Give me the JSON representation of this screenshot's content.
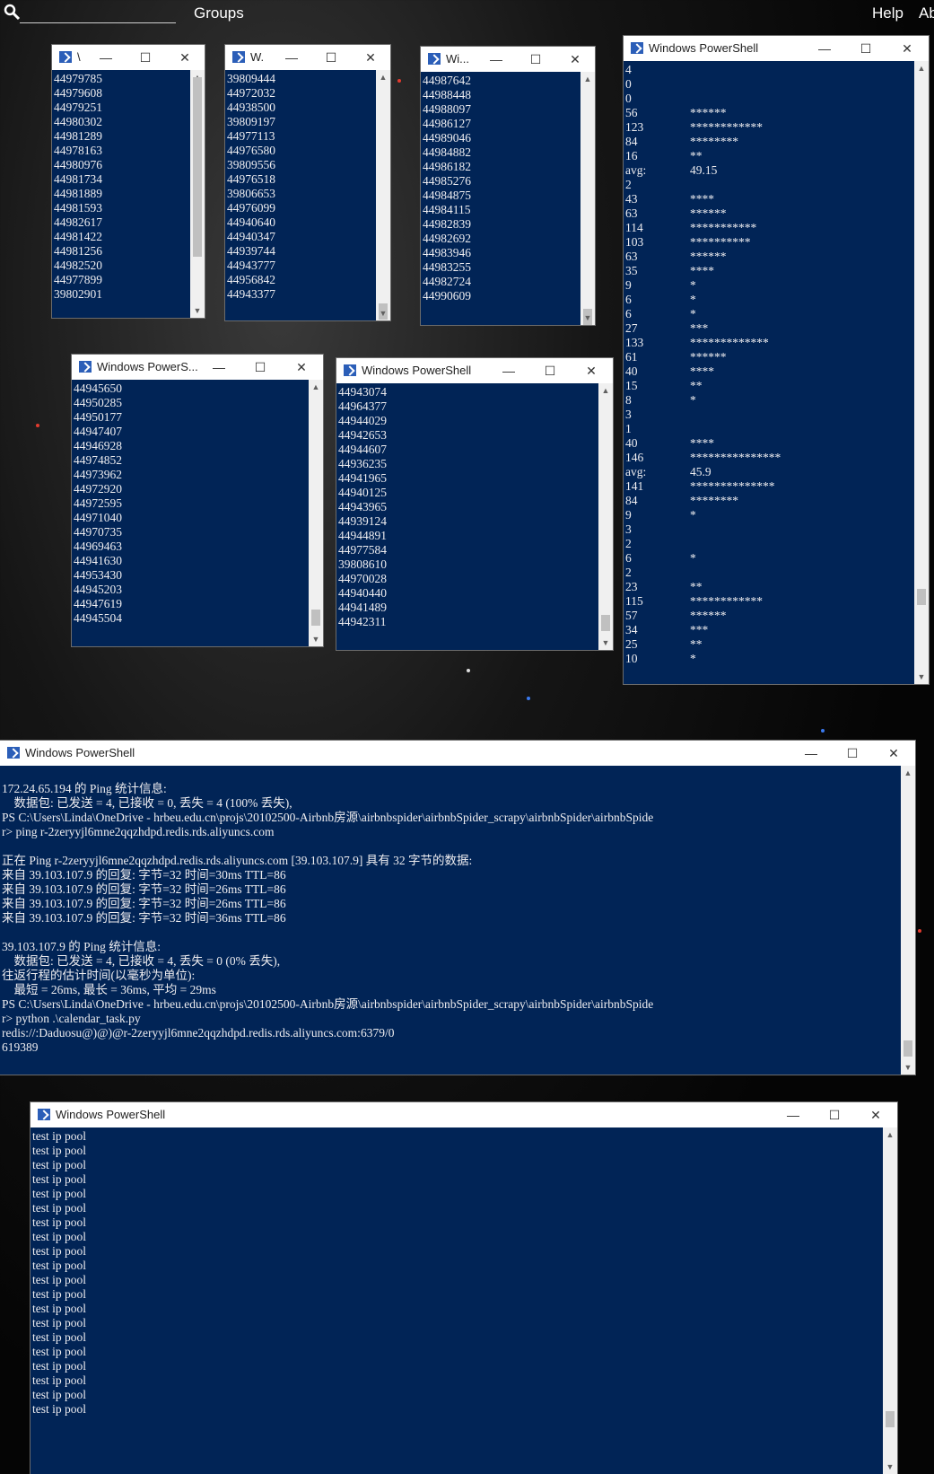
{
  "topbar": {
    "search_icon": "search-icon",
    "groups": "Groups",
    "help": "Help",
    "about": "Ab"
  },
  "windows": {
    "w1": {
      "title": "\\",
      "lines": [
        "44979785",
        "44979608",
        "44979251",
        "44980302",
        "44981289",
        "44978163",
        "44980976",
        "44981734",
        "44981889",
        "44981593",
        "44982617",
        "44981422",
        "44981256",
        "44982520",
        "44977899",
        "39802901"
      ]
    },
    "w2": {
      "title": "W.",
      "lines": [
        "39809444",
        "44972032",
        "44938500",
        "39809197",
        "44977113",
        "44976580",
        "39809556",
        "44976518",
        "39806653",
        "44976099",
        "44940640",
        "44940347",
        "44939744",
        "44943777",
        "44956842",
        "44943377"
      ]
    },
    "w3": {
      "title": "Wi...",
      "lines": [
        "44987642",
        "44988448",
        "44988097",
        "44986127",
        "44989046",
        "44984882",
        "44986182",
        "44985276",
        "44984875",
        "44984115",
        "44982839",
        "44982692",
        "44983946",
        "44983255",
        "44982724",
        "44990609"
      ]
    },
    "w4": {
      "title": "Windows PowerShell",
      "lines": [
        [
          "4",
          ""
        ],
        [
          "0",
          ""
        ],
        [
          "0",
          ""
        ],
        [
          "56",
          "******"
        ],
        [
          "123",
          "************"
        ],
        [
          "84",
          "********"
        ],
        [
          "16",
          "**"
        ],
        [
          "avg:",
          "49.15"
        ],
        [
          "2",
          ""
        ],
        [
          "43",
          "****"
        ],
        [
          "63",
          "******"
        ],
        [
          "114",
          "***********"
        ],
        [
          "103",
          "**********"
        ],
        [
          "63",
          "******"
        ],
        [
          "35",
          "****"
        ],
        [
          "9",
          "*"
        ],
        [
          "6",
          "*"
        ],
        [
          "6",
          "*"
        ],
        [
          "27",
          "***"
        ],
        [
          "133",
          "*************"
        ],
        [
          "61",
          "******"
        ],
        [
          "40",
          "****"
        ],
        [
          "15",
          "**"
        ],
        [
          "8",
          "*"
        ],
        [
          "3",
          ""
        ],
        [
          "1",
          ""
        ],
        [
          "40",
          "****"
        ],
        [
          "146",
          "***************"
        ],
        [
          "avg:",
          "45.9"
        ],
        [
          "141",
          "**************"
        ],
        [
          "84",
          "********"
        ],
        [
          "9",
          "*"
        ],
        [
          "3",
          ""
        ],
        [
          "2",
          ""
        ],
        [
          "6",
          "*"
        ],
        [
          "2",
          ""
        ],
        [
          "23",
          "**"
        ],
        [
          "115",
          "************"
        ],
        [
          "57",
          "******"
        ],
        [
          "34",
          "***"
        ],
        [
          "25",
          "**"
        ],
        [
          "10",
          "*"
        ]
      ]
    },
    "w5": {
      "title": "Windows PowerS...",
      "lines": [
        "44945650",
        "44950285",
        "44950177",
        "44947407",
        "44946928",
        "44974852",
        "44973962",
        "44972920",
        "44972595",
        "44971040",
        "44970735",
        "44969463",
        "44941630",
        "44953430",
        "44945203",
        "44947619",
        "44945504"
      ]
    },
    "w6": {
      "title": "Windows PowerShell",
      "lines": [
        "44943074",
        "44964377",
        "44944029",
        "44942653",
        "44944607",
        "44936235",
        "44941965",
        "44940125",
        "44943965",
        "44939124",
        "44944891",
        "44977584",
        "39808610",
        "44970028",
        "44940440",
        "44941489",
        "44942311"
      ]
    },
    "w7": {
      "title": "Windows PowerShell",
      "lines": [
        "",
        "172.24.65.194 的 Ping 统计信息:",
        "    数据包: 已发送 = 4, 已接收 = 0, 丢失 = 4 (100% 丢失),",
        "PS C:\\Users\\Linda\\OneDrive - hrbeu.edu.cn\\projs\\20102500-Airbnb房源\\airbnbspider\\airbnbSpider_scrapy\\airbnbSpider\\airbnbSpide",
        "r> ping r-2zeryyjl6mne2qqzhdpd.redis.rds.aliyuncs.com",
        "",
        "正在 Ping r-2zeryyjl6mne2qqzhdpd.redis.rds.aliyuncs.com [39.103.107.9] 具有 32 字节的数据:",
        "来自 39.103.107.9 的回复: 字节=32 时间=30ms TTL=86",
        "来自 39.103.107.9 的回复: 字节=32 时间=26ms TTL=86",
        "来自 39.103.107.9 的回复: 字节=32 时间=26ms TTL=86",
        "来自 39.103.107.9 的回复: 字节=32 时间=36ms TTL=86",
        "",
        "39.103.107.9 的 Ping 统计信息:",
        "    数据包: 已发送 = 4, 已接收 = 4, 丢失 = 0 (0% 丢失),",
        "往返行程的估计时间(以毫秒为单位):",
        "    最短 = 26ms, 最长 = 36ms, 平均 = 29ms",
        "PS C:\\Users\\Linda\\OneDrive - hrbeu.edu.cn\\projs\\20102500-Airbnb房源\\airbnbspider\\airbnbSpider_scrapy\\airbnbSpider\\airbnbSpide",
        "r> python .\\calendar_task.py",
        "redis://:Daduosu@)@)@r-2zeryyjl6mne2qqzhdpd.redis.rds.aliyuncs.com:6379/0",
        "619389"
      ]
    },
    "w8": {
      "title": "Windows PowerShell",
      "lines": [
        "test ip pool",
        "test ip pool",
        "test ip pool",
        "test ip pool",
        "test ip pool",
        "test ip pool",
        "test ip pool",
        "test ip pool",
        "test ip pool",
        "test ip pool",
        "test ip pool",
        "test ip pool",
        "test ip pool",
        "test ip pool",
        "test ip pool",
        "test ip pool",
        "test ip pool",
        "test ip pool",
        "test ip pool",
        "test ip pool"
      ]
    }
  },
  "controls": {
    "minimize": "—",
    "maximize": "☐",
    "close": "✕"
  }
}
